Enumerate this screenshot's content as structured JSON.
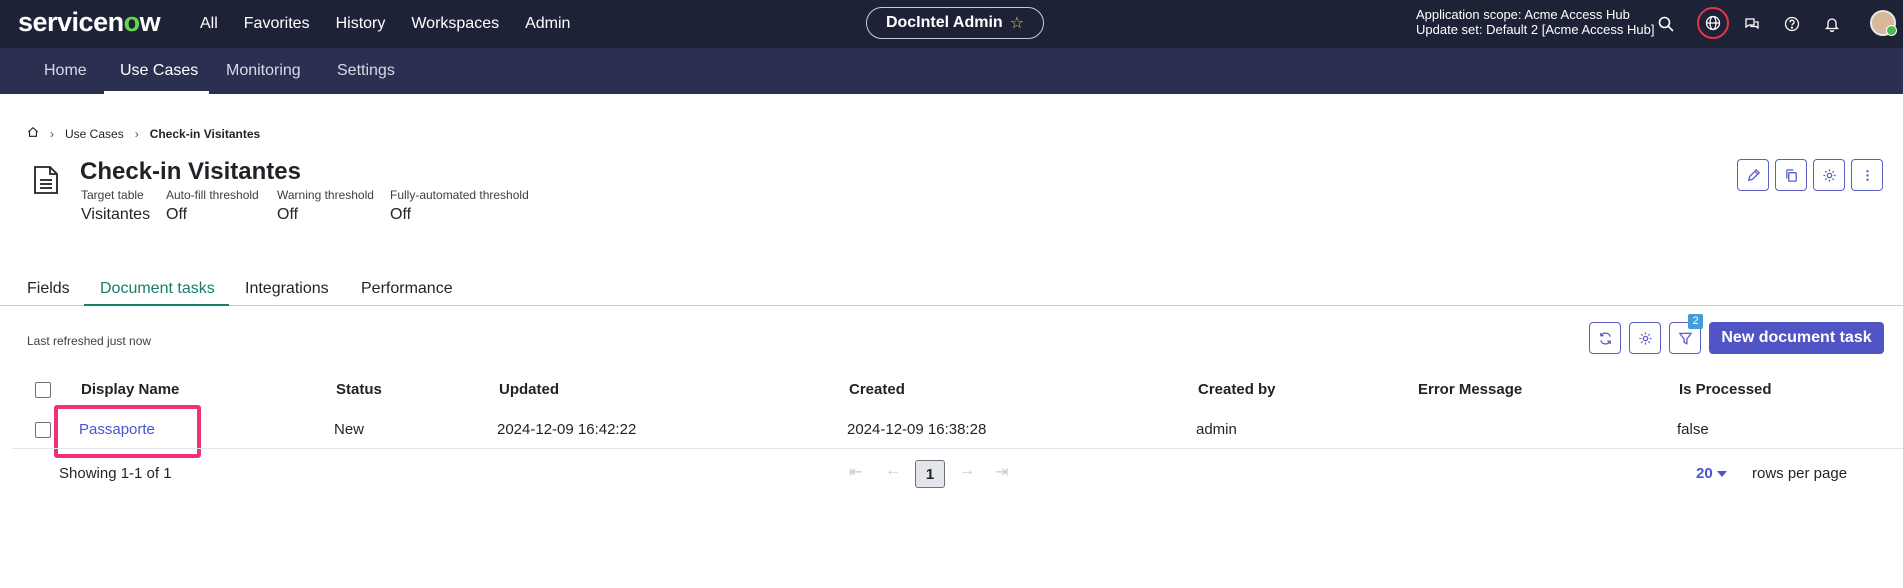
{
  "brand": {
    "name_part1": "servicen",
    "name_o": "o",
    "name_part2": "w",
    "accent": "#62d84e"
  },
  "topnav": {
    "items": [
      "All",
      "Favorites",
      "History",
      "Workspaces",
      "Admin"
    ]
  },
  "workspace_pill": {
    "label": "DocIntel Admin",
    "star_icon": "star-icon"
  },
  "scope": {
    "line1": "Application scope: Acme Access Hub",
    "line2": "Update set: Default 2 [Acme Access Hub]"
  },
  "topbar_icons": [
    "search-icon",
    "globe-icon",
    "chat-icon",
    "help-icon",
    "bell-icon"
  ],
  "subnav": {
    "items": [
      "Home",
      "Use Cases",
      "Monitoring",
      "Settings"
    ],
    "active": "Use Cases"
  },
  "breadcrumb": {
    "items": [
      "Use Cases",
      "Check-in Visitantes"
    ]
  },
  "header": {
    "title": "Check-in Visitantes",
    "meta": [
      {
        "label": "Target table",
        "value": "Visitantes"
      },
      {
        "label": "Auto-fill threshold",
        "value": "Off"
      },
      {
        "label": "Warning threshold",
        "value": "Off"
      },
      {
        "label": "Fully-automated threshold",
        "value": "Off"
      }
    ]
  },
  "tabs": {
    "items": [
      "Fields",
      "Document tasks",
      "Integrations",
      "Performance"
    ],
    "active": "Document tasks"
  },
  "toolbar": {
    "refreshed_text": "Last refreshed just now",
    "filter_count": "2",
    "new_button": "New document task"
  },
  "table": {
    "columns": [
      "Display Name",
      "Status",
      "Updated",
      "Created",
      "Created by",
      "Error Message",
      "Is Processed"
    ],
    "rows": [
      {
        "display_name": "Passaporte",
        "status": "New",
        "updated": "2024-12-09 16:42:22",
        "created": "2024-12-09 16:38:28",
        "created_by": "admin",
        "error_message": "",
        "is_processed": "false"
      }
    ]
  },
  "pagination": {
    "showing": "Showing 1-1 of 1",
    "current_page": "1",
    "rows_per_page_value": "20",
    "rows_per_page_label": "rows per page"
  },
  "colors": {
    "topbar": "#1e2236",
    "subnav": "#2b3050",
    "primary": "#5054c4",
    "active_tab": "#147e6b",
    "highlight": "#f0317a"
  }
}
